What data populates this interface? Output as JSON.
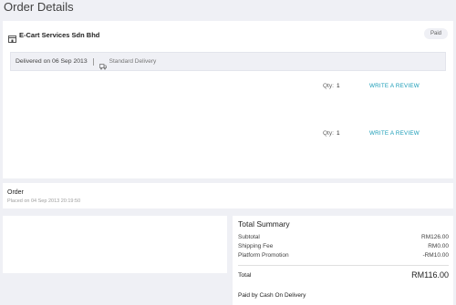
{
  "page": {
    "title": "Order Details"
  },
  "package": {
    "seller_name": "E-Cart Services Sdn Bhd",
    "status_badge": "Paid",
    "delivered_text": "Delivered on 06 Sep 2013",
    "delivery_method": "Standard Delivery",
    "items": [
      {
        "qty_label": "Qty:",
        "qty": "1",
        "review_label": "WRITE A REVIEW"
      },
      {
        "qty_label": "Qty:",
        "qty": "1",
        "review_label": "WRITE A REVIEW"
      }
    ]
  },
  "order": {
    "title": "Order",
    "placed": "Placed on 04 Sep 2013 20:19:50"
  },
  "summary": {
    "title": "Total Summary",
    "lines": [
      {
        "label": "Subtotal",
        "value": "RM126.00"
      },
      {
        "label": "Shipping Fee",
        "value": "RM0.00"
      },
      {
        "label": "Platform Promotion",
        "value": "-RM10.00"
      }
    ],
    "total_label": "Total",
    "total_value": "RM116.00",
    "payment": "Paid by Cash On Delivery"
  },
  "colors": {
    "link": "#1a9cb7",
    "page_bg": "#eff0f5"
  },
  "icons": {
    "seller": "store-icon",
    "delivery": "truck-icon"
  }
}
